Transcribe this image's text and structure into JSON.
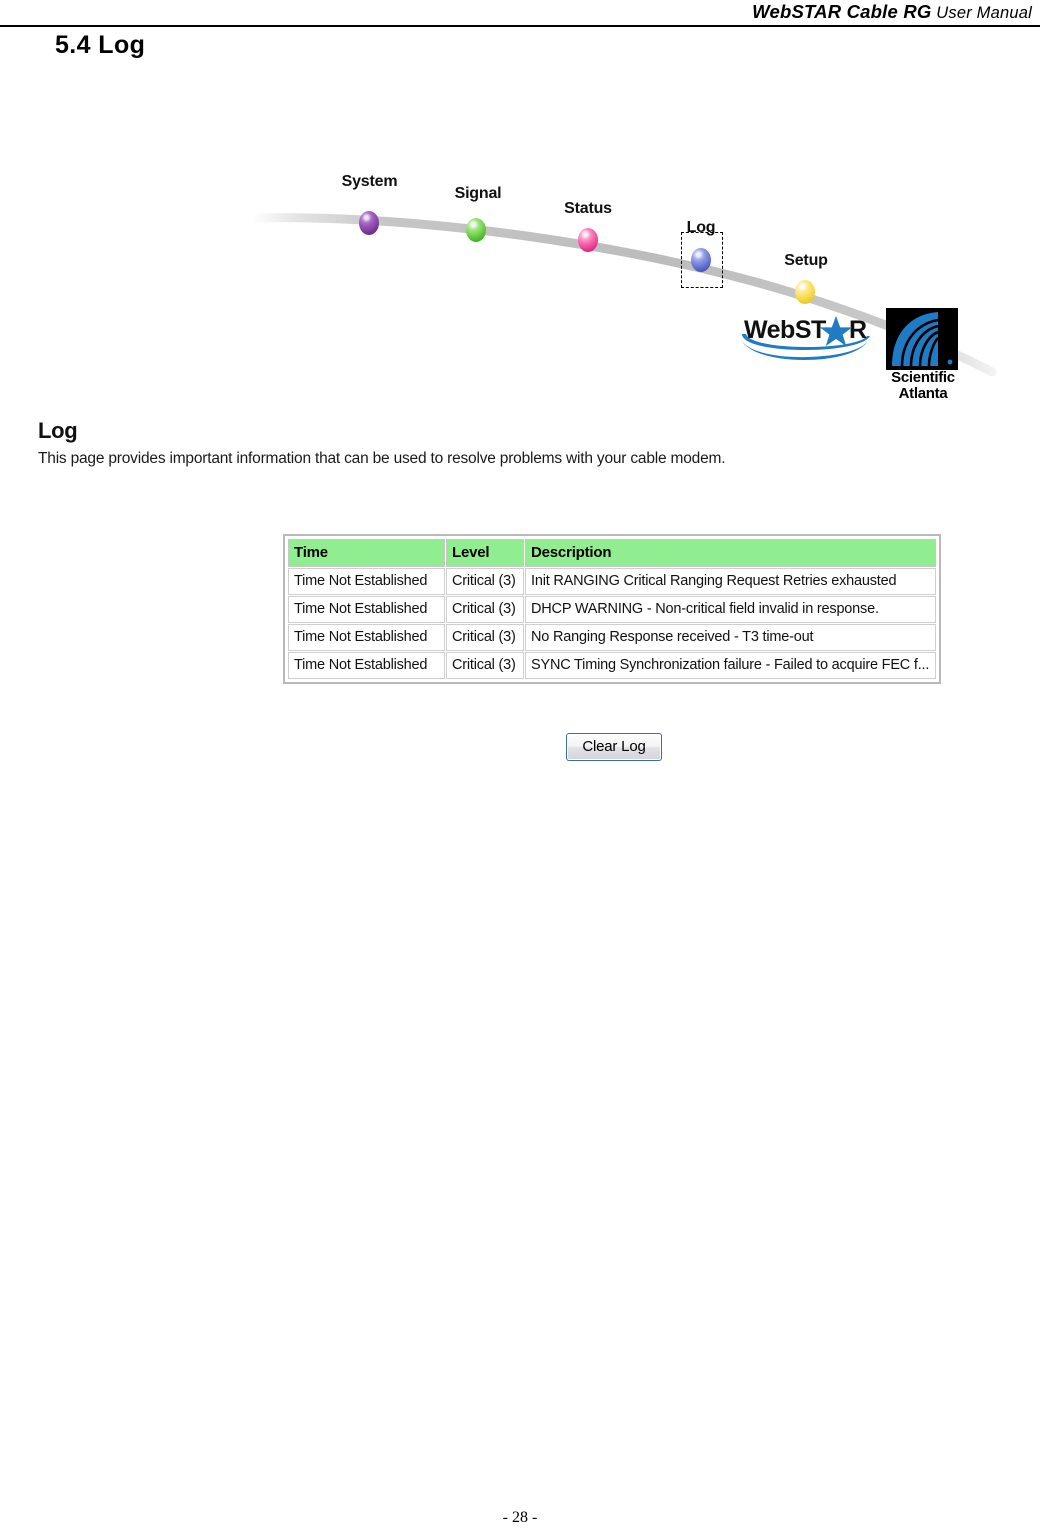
{
  "header": {
    "title_bold": "WebSTAR Cable RG",
    "title_light": " User Manual"
  },
  "section": {
    "heading": "5.4 Log"
  },
  "nav": {
    "items": [
      {
        "label": "System",
        "color": "#8a3fb0",
        "state": "normal"
      },
      {
        "label": "Signal",
        "color": "#4fc02e",
        "state": "normal"
      },
      {
        "label": "Status",
        "color": "#ec2f87",
        "state": "normal"
      },
      {
        "label": "Log",
        "color": "#5565c8",
        "state": "selected"
      },
      {
        "label": "Setup",
        "color": "#f0cf2a",
        "state": "normal"
      }
    ]
  },
  "logos": {
    "webstar": "WebSTAR",
    "webstar_prefix": "WebST",
    "webstar_suffix": "R",
    "scientific_atlanta_line1": "Scientific",
    "scientific_atlanta_line2": "Atlanta"
  },
  "page": {
    "title": "Log",
    "description": "This page provides important information that can be used to resolve problems with your cable modem."
  },
  "log_table": {
    "columns": [
      "Time",
      "Level",
      "Description"
    ],
    "rows": [
      [
        "Time Not Established",
        "Critical (3)",
        "Init RANGING Critical Ranging Request Retries exhausted"
      ],
      [
        "Time Not Established",
        "Critical (3)",
        "DHCP WARNING - Non-critical field invalid in response."
      ],
      [
        "Time Not Established",
        "Critical (3)",
        "No Ranging Response received - T3 time-out"
      ],
      [
        "Time Not Established",
        "Critical (3)",
        "SYNC Timing Synchronization failure - Failed to acquire FEC f..."
      ]
    ],
    "header_background": "#90ee90"
  },
  "actions": {
    "clear_log_label": "Clear Log"
  },
  "footer": {
    "page_number": "- 28 -"
  }
}
